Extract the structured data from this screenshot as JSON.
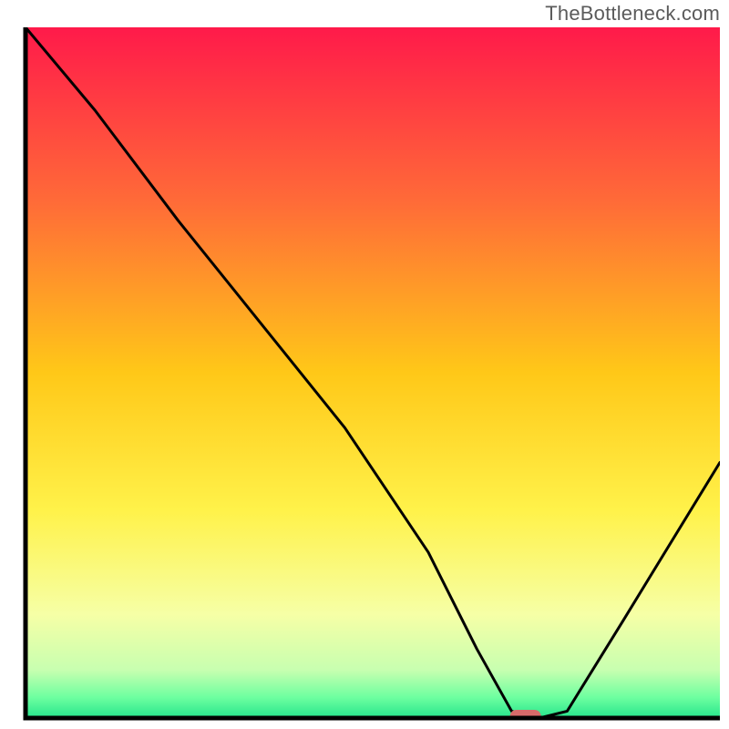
{
  "watermark": "TheBottleneck.com",
  "chart_data": {
    "type": "line",
    "title": "",
    "xlabel": "",
    "ylabel": "",
    "xlim": [
      0,
      100
    ],
    "ylim": [
      0,
      100
    ],
    "grid": false,
    "background_gradient": [
      {
        "pos": 0.0,
        "color": "#ff1a4a"
      },
      {
        "pos": 0.25,
        "color": "#ff6a38"
      },
      {
        "pos": 0.5,
        "color": "#ffc818"
      },
      {
        "pos": 0.7,
        "color": "#fff24a"
      },
      {
        "pos": 0.85,
        "color": "#f6ffa6"
      },
      {
        "pos": 0.93,
        "color": "#c8ffb0"
      },
      {
        "pos": 0.97,
        "color": "#6effa0"
      },
      {
        "pos": 1.0,
        "color": "#25e58c"
      }
    ],
    "series": [
      {
        "name": "bottleneck-curve",
        "x": [
          0,
          10,
          22,
          34,
          46,
          58,
          65,
          70,
          74,
          78,
          86,
          100
        ],
        "y": [
          100,
          88,
          72,
          57,
          42,
          24,
          10,
          1,
          0,
          1,
          14,
          37
        ]
      }
    ],
    "marker": {
      "name": "optimal-point",
      "x": 72,
      "y": 0,
      "color": "#d86a6a"
    },
    "axes_color": "#000000",
    "line_color": "#000000",
    "line_width": 3
  }
}
